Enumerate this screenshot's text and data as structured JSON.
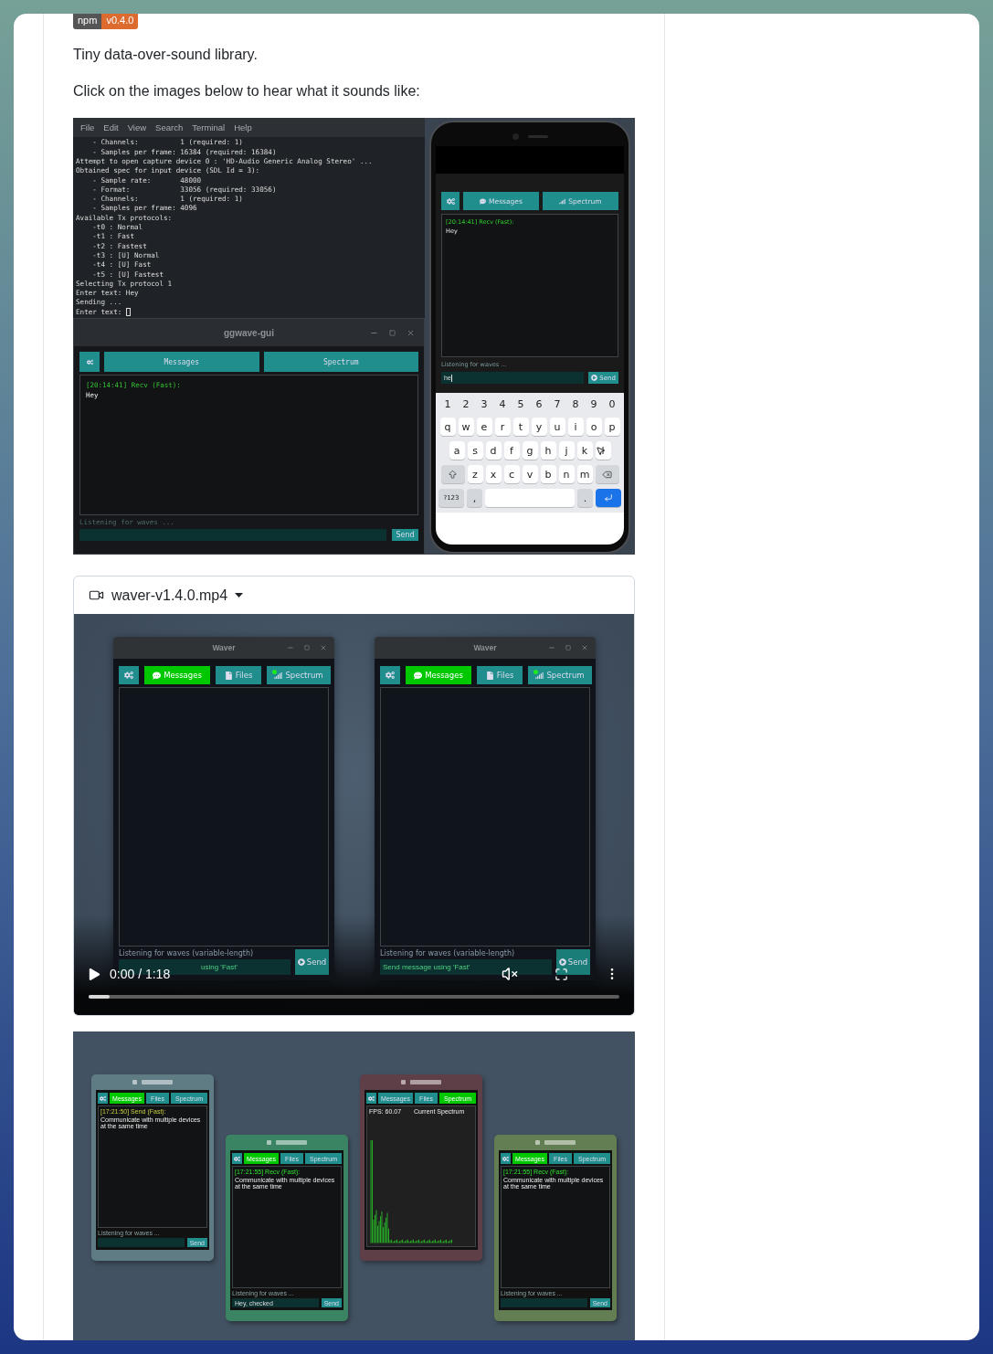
{
  "badge": {
    "label": "npm",
    "version": "v0.4.0"
  },
  "intro": "Tiny data-over-sound library.",
  "hint": "Click on the images below to hear what it sounds like:",
  "demo_image": {
    "terminal": {
      "menu": [
        "File",
        "Edit",
        "View",
        "Search",
        "Terminal",
        "Help"
      ],
      "lines": [
        "    - Channels:          1 (required: 1)",
        "    - Samples per frame: 16384 (required: 16384)",
        "Attempt to open capture device 0 : 'HD-Audio Generic Analog Stereo' ...",
        "Obtained spec for input device (SDL Id = 3):",
        "    - Sample rate:       48000",
        "    - Format:            33056 (required: 33056)",
        "    - Channels:          1 (required: 1)",
        "    - Samples per frame: 4096",
        "Available Tx protocols:",
        "    -t0 : Normal",
        "    -t1 : Fast",
        "    -t2 : Fastest",
        "    -t3 : [U] Normal",
        "    -t4 : [U] Fast",
        "    -t5 : [U] Fastest",
        "Selecting Tx protocol 1",
        "Enter text: Hey",
        "Sending ...",
        "Enter text: "
      ]
    },
    "gui_window": {
      "title": "ggwave-gui",
      "tabs": [
        "Messages",
        "Spectrum"
      ],
      "message": {
        "header": "[20:14:41] Recv (Fast):",
        "body": "Hey"
      },
      "status": "Listening for waves ...",
      "send": "Send"
    },
    "phone": {
      "tabs": [
        "Messages",
        "Spectrum"
      ],
      "message": {
        "header": "[20:14:41] Recv (Fast):",
        "body": "Hey"
      },
      "status": "Listening for waves ...",
      "input": "he",
      "send": "Send",
      "keyboard": {
        "numbers": [
          "1",
          "2",
          "3",
          "4",
          "5",
          "6",
          "7",
          "8",
          "9",
          "0"
        ],
        "rows": [
          [
            "q",
            "w",
            "e",
            "r",
            "t",
            "y",
            "u",
            "i",
            "o",
            "p"
          ],
          [
            "a",
            "s",
            "d",
            "f",
            "g",
            "h",
            "j",
            "k",
            "l"
          ],
          [
            "z",
            "x",
            "c",
            "v",
            "b",
            "n",
            "m"
          ]
        ],
        "mode_key": "?123",
        "comma": ",",
        "period": "."
      }
    }
  },
  "video": {
    "filename": "waver-v1.4.0.mp4",
    "windows": [
      {
        "title": "Waver",
        "tabs": [
          {
            "label": "Messages",
            "selected": true
          },
          {
            "label": "Files",
            "selected": false
          },
          {
            "label": "Spectrum",
            "selected": false
          }
        ],
        "status": "Listening for waves (variable-length)",
        "placeholder": "using 'Fast'",
        "send": "Send"
      },
      {
        "title": "Waver",
        "tabs": [
          {
            "label": "Messages",
            "selected": true
          },
          {
            "label": "Files",
            "selected": false
          },
          {
            "label": "Spectrum",
            "selected": false
          }
        ],
        "status": "Listening for waves (variable-length)",
        "placeholder": "Send message using 'Fast'",
        "send": "Send"
      }
    ],
    "time": "0:00 / 1:18",
    "muted": true,
    "level": 0.04
  },
  "devices_image": {
    "devices": [
      {
        "color": "#5f7c85",
        "tabs": [
          {
            "label": "Messages",
            "selected": true
          },
          {
            "label": "Files",
            "selected": false
          },
          {
            "label": "Spectrum",
            "selected": false
          }
        ],
        "view": {
          "kind": "messages",
          "header": "[17:21:50] Send (Fast):",
          "outgoing": true,
          "body": "Communicate with multiple devices at the same time"
        },
        "status": "Listening for waves ...",
        "send": "Send"
      },
      {
        "color": "#3a8464",
        "tabs": [
          {
            "label": "Messages",
            "selected": true
          },
          {
            "label": "Files",
            "selected": false
          },
          {
            "label": "Spectrum",
            "selected": false
          }
        ],
        "view": {
          "kind": "messages",
          "header": "[17:21:55] Recv (Fast):",
          "outgoing": false,
          "body": "Communicate with multiple devices at the same time"
        },
        "status": "Listening for waves ...",
        "input": "Hey, checked",
        "send": "Send"
      },
      {
        "color": "#5e3f48",
        "tabs": [
          {
            "label": "Messages",
            "selected": false
          },
          {
            "label": "Files",
            "selected": false
          },
          {
            "label": "Spectrum",
            "selected": true
          }
        ],
        "view": {
          "kind": "spectrum",
          "fps": "FPS: 60.07",
          "title": "Current Spectrum"
        }
      },
      {
        "color": "#627e52",
        "tabs": [
          {
            "label": "Messages",
            "selected": true
          },
          {
            "label": "Files",
            "selected": false
          },
          {
            "label": "Spectrum",
            "selected": false
          }
        ],
        "view": {
          "kind": "messages",
          "header": "[17:21:55] Recv (Fast):",
          "outgoing": false,
          "body": "Communicate with multiple devices at the same time"
        },
        "status": "Listening for waves ...",
        "send": "Send"
      }
    ]
  }
}
